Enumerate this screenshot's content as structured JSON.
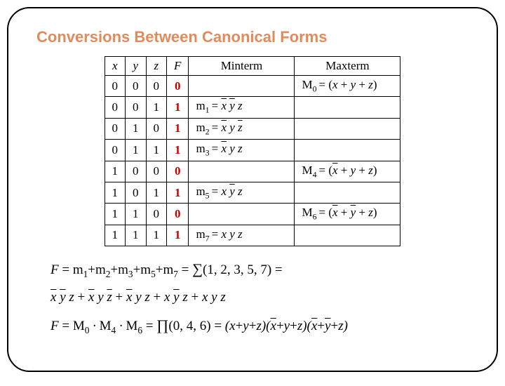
{
  "title": "Conversions Between Canonical Forms",
  "headers": {
    "x": "x",
    "y": "y",
    "z": "z",
    "F": "F",
    "minterm": "Minterm",
    "maxterm": "Maxterm"
  },
  "rows": [
    {
      "x": "0",
      "y": "0",
      "z": "0",
      "F": "0",
      "minterm": "",
      "maxterm": "M0 = (x + y + z)"
    },
    {
      "x": "0",
      "y": "0",
      "z": "1",
      "F": "1",
      "minterm": "m1 = x̄ ȳ z",
      "maxterm": ""
    },
    {
      "x": "0",
      "y": "1",
      "z": "0",
      "F": "1",
      "minterm": "m2 = x̄ y z̄",
      "maxterm": ""
    },
    {
      "x": "0",
      "y": "1",
      "z": "1",
      "F": "1",
      "minterm": "m3 = x̄ y z",
      "maxterm": ""
    },
    {
      "x": "1",
      "y": "0",
      "z": "0",
      "F": "0",
      "minterm": "",
      "maxterm": "M4 = (x̄ + y + z)"
    },
    {
      "x": "1",
      "y": "0",
      "z": "1",
      "F": "1",
      "minterm": "m5 = x ȳ z",
      "maxterm": ""
    },
    {
      "x": "1",
      "y": "1",
      "z": "0",
      "F": "0",
      "minterm": "",
      "maxterm": "M6 = (x̄ + ȳ + z)"
    },
    {
      "x": "1",
      "y": "1",
      "z": "1",
      "F": "1",
      "minterm": "m7 = x y z",
      "maxterm": ""
    }
  ],
  "equations": {
    "line1_sum": "F = m1+m2+m3+m5+m7 = ∑(1, 2, 3, 5, 7) =",
    "line2_sop": "x̄ ȳ z + x̄ y z̄ + x̄ y z + x ȳ z + x y z",
    "line3_prod": "F = M0 · M4 · M6 = ∏(0, 4, 6) = (x+y+z)(x̄+y+z)(x̄+ȳ+z)"
  }
}
